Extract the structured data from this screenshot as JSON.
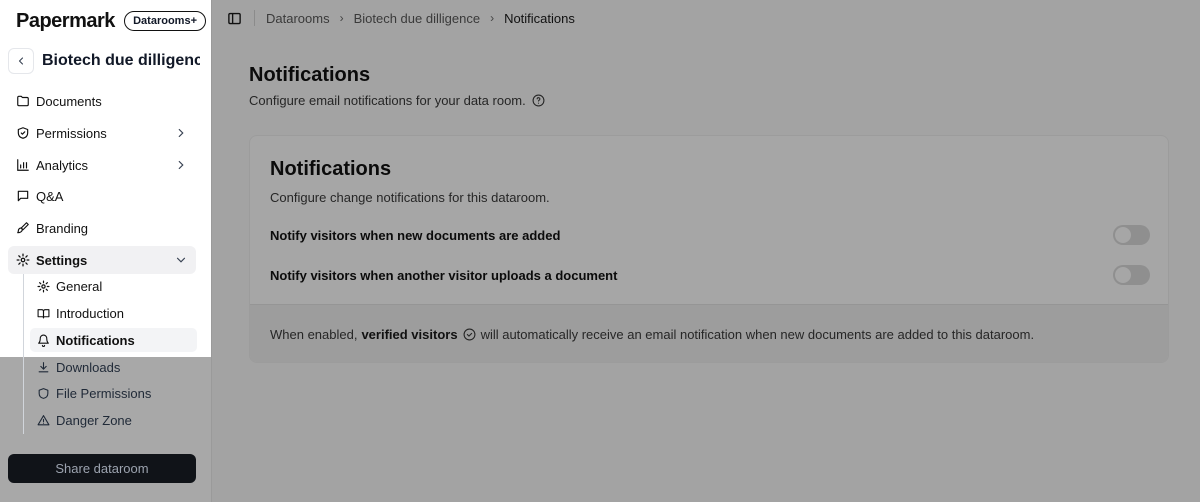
{
  "brand": {
    "logo": "Papermark",
    "plan": "Datarooms+"
  },
  "dataroom": {
    "name": "Biotech due dilligence"
  },
  "nav": {
    "documents": "Documents",
    "permissions": "Permissions",
    "analytics": "Analytics",
    "qa": "Q&A",
    "branding": "Branding",
    "settings": "Settings"
  },
  "settings_sub": {
    "general": "General",
    "introduction": "Introduction",
    "notifications": "Notifications",
    "downloads": "Downloads",
    "file_permissions": "File Permissions",
    "danger_zone": "Danger Zone"
  },
  "share_button": "Share dataroom",
  "breadcrumb": [
    "Datarooms",
    "Biotech due dilligence",
    "Notifications"
  ],
  "page": {
    "title": "Notifications",
    "subtitle": "Configure email notifications for your data room."
  },
  "card": {
    "title": "Notifications",
    "subtitle": "Configure change notifications for this dataroom.",
    "settings": [
      {
        "label": "Notify visitors when new documents are added",
        "enabled": false
      },
      {
        "label": "Notify visitors when another visitor uploads a document",
        "enabled": false
      }
    ],
    "footer_prefix": "When enabled,",
    "footer_bold": "verified visitors",
    "footer_suffix": "will automatically receive an email notification when new documents are added to this dataroom."
  }
}
